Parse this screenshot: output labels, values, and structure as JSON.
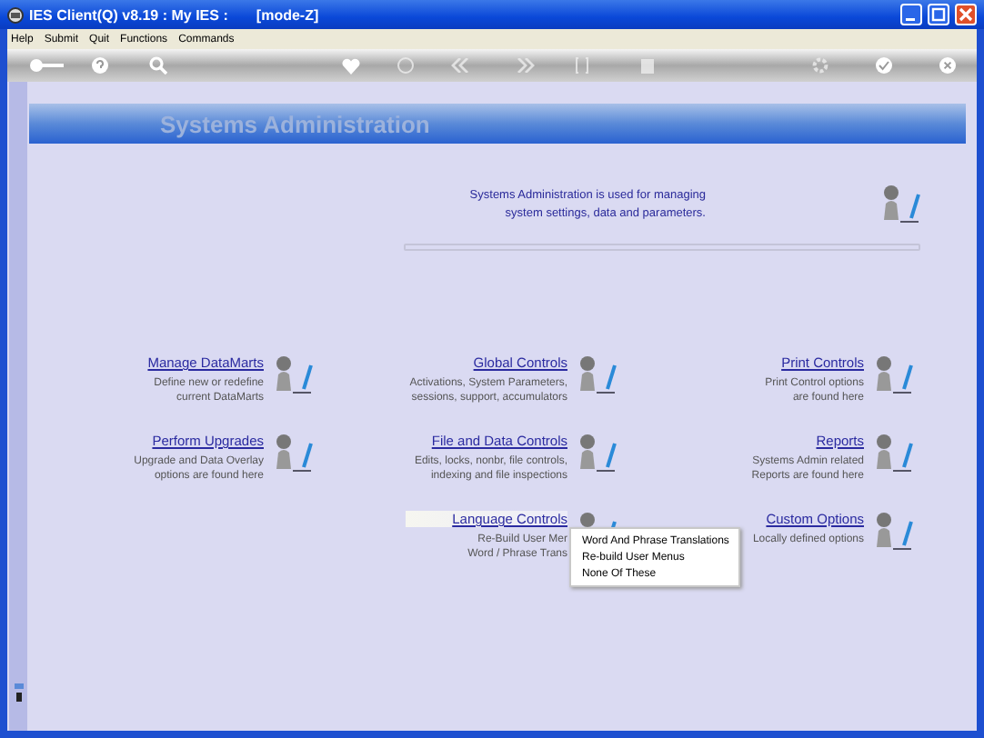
{
  "window": {
    "title": "IES Client(Q) v8.19 : My IES :       [mode-Z]"
  },
  "menu": [
    "Help",
    "Submit",
    "Quit",
    "Functions",
    "Commands"
  ],
  "header": {
    "title": "Systems Administration"
  },
  "intro": [
    "Systems Administration is used for managing",
    "system settings, data and parameters."
  ],
  "columns": [
    {
      "options": [
        {
          "title": "Manage DataMarts",
          "lines": [
            "Define new or redefine",
            "current DataMarts"
          ],
          "hovered": false
        },
        {
          "title": "Perform Upgrades",
          "lines": [
            "Upgrade and Data Overlay",
            "options are found here"
          ],
          "hovered": false
        }
      ]
    },
    {
      "options": [
        {
          "title": "Global Controls",
          "lines": [
            "Activations, System Parameters,",
            "sessions, support, accumulators"
          ],
          "hovered": false
        },
        {
          "title": "File and Data Controls",
          "lines": [
            "Edits, locks, nonbr, file controls,",
            "indexing and file inspections"
          ],
          "hovered": false
        },
        {
          "title": "Language Controls",
          "lines": [
            "Re-Build User Mer",
            "Word / Phrase Trans"
          ],
          "hovered": true
        }
      ]
    },
    {
      "options": [
        {
          "title": "Print Controls",
          "lines": [
            "Print Control options",
            "are found here"
          ],
          "hovered": false
        },
        {
          "title": "Reports",
          "lines": [
            "Systems Admin related",
            "Reports are found here"
          ],
          "hovered": false
        },
        {
          "title": "Custom Options",
          "lines": [
            "Locally defined options"
          ],
          "hovered": false
        }
      ]
    }
  ],
  "popup_menu": {
    "items": [
      "Word And Phrase Translations",
      "Re-build User Menus",
      "None Of These"
    ]
  }
}
